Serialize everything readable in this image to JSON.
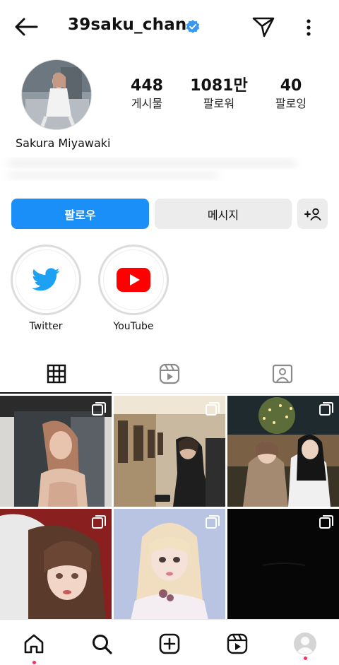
{
  "header": {
    "username": "39saku_chan"
  },
  "profile": {
    "full_name": "Sakura Miyawaki",
    "stats": [
      {
        "value": "448",
        "label": "게시물"
      },
      {
        "value": "1081만",
        "label": "팔로워"
      },
      {
        "value": "40",
        "label": "팔로잉"
      }
    ]
  },
  "actions": {
    "follow_label": "팔로우",
    "message_label": "메시지"
  },
  "highlights": [
    {
      "label": "Twitter",
      "icon": "twitter-bird-icon"
    },
    {
      "label": "YouTube",
      "icon": "youtube-play-icon"
    }
  ],
  "tabs": [
    {
      "icon": "grid-icon",
      "active": true
    },
    {
      "icon": "reels-icon",
      "active": false
    },
    {
      "icon": "tagged-icon",
      "active": false
    }
  ],
  "colors": {
    "accent": "#1a8ff7",
    "verified": "#3897f0",
    "twitter": "#1da1f2",
    "youtube": "#ff0000",
    "notification_dot": "#ff2d55"
  },
  "bottom_nav": [
    {
      "icon": "home-icon"
    },
    {
      "icon": "search-icon"
    },
    {
      "icon": "create-icon"
    },
    {
      "icon": "reels-icon"
    },
    {
      "icon": "profile-avatar-icon"
    }
  ]
}
